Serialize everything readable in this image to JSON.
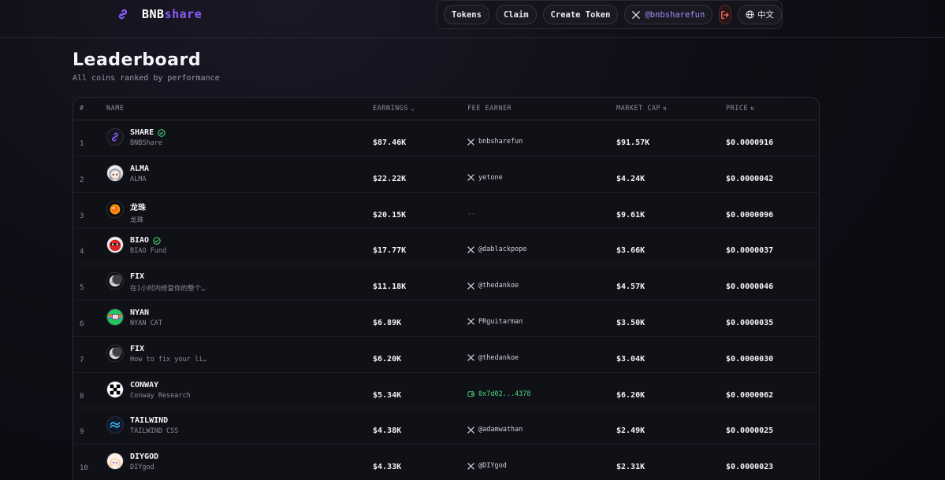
{
  "brand": {
    "part1": "BNB",
    "part2": "share",
    "icon": "link-icon",
    "accent": "#8b5cf6"
  },
  "nav": {
    "tokens": "Tokens",
    "claim": "Claim",
    "create_token": "Create Token",
    "twitter_handle": "@bnbsharefun",
    "language": "中文"
  },
  "page": {
    "title": "Leaderboard",
    "subtitle": "All coins ranked by performance"
  },
  "table": {
    "headers": {
      "rank": "#",
      "name": "NAME",
      "earnings": "EARNINGS",
      "fee_earner": "FEE EARNER",
      "market_cap": "MARKET CAP",
      "price": "PRICE"
    },
    "rows": [
      {
        "rank": "1",
        "name": "SHARE",
        "sub": "BNBShare",
        "verified": true,
        "earnings": "$87.46K",
        "fee_type": "x",
        "fee": "bnbsharefun",
        "mcap": "$91.57K",
        "price": "$0.0000916",
        "avatar": "link-icon"
      },
      {
        "rank": "2",
        "name": "ALMA",
        "sub": "ALMA",
        "verified": false,
        "earnings": "$22.22K",
        "fee_type": "x",
        "fee": "yetone",
        "mcap": "$4.24K",
        "price": "$0.0000042",
        "avatar": "anime-face-icon"
      },
      {
        "rank": "3",
        "name": "龙珠",
        "sub": "龙珠",
        "verified": false,
        "earnings": "$20.15K",
        "fee_type": "none",
        "fee": "--",
        "mcap": "$9.61K",
        "price": "$0.0000096",
        "avatar": "orange-ball-icon"
      },
      {
        "rank": "4",
        "name": "BIAO",
        "sub": "BIAO Fund",
        "verified": true,
        "earnings": "$17.77K",
        "fee_type": "x",
        "fee": "@dablackpope",
        "mcap": "$3.66K",
        "price": "$0.0000037",
        "avatar": "red-face-icon"
      },
      {
        "rank": "5",
        "name": "FIX",
        "sub": "在1小时内修复你的整个…",
        "verified": false,
        "earnings": "$11.18K",
        "fee_type": "x",
        "fee": "@thedankoe",
        "mcap": "$4.57K",
        "price": "$0.0000046",
        "avatar": "moon-icon"
      },
      {
        "rank": "6",
        "name": "NYAN",
        "sub": "NYAN CAT",
        "verified": false,
        "earnings": "$6.89K",
        "fee_type": "x",
        "fee": "PRguitarman",
        "mcap": "$3.50K",
        "price": "$0.0000035",
        "avatar": "nyan-cat-icon"
      },
      {
        "rank": "7",
        "name": "FIX",
        "sub": "How to fix your li…",
        "verified": false,
        "earnings": "$6.20K",
        "fee_type": "x",
        "fee": "@thedankoe",
        "mcap": "$3.04K",
        "price": "$0.0000030",
        "avatar": "moon-icon"
      },
      {
        "rank": "8",
        "name": "CONWAY",
        "sub": "Conway Research",
        "verified": false,
        "earnings": "$5.34K",
        "fee_type": "wallet",
        "fee": "0x7d02...4378",
        "mcap": "$6.20K",
        "price": "$0.0000062",
        "avatar": "conway-icon"
      },
      {
        "rank": "9",
        "name": "TAILWIND",
        "sub": "TAILWIND CSS",
        "verified": false,
        "earnings": "$4.38K",
        "fee_type": "x",
        "fee": "@adamwathan",
        "mcap": "$2.49K",
        "price": "$0.0000025",
        "avatar": "tailwind-icon"
      },
      {
        "rank": "10",
        "name": "DIYGOD",
        "sub": "DIYgod",
        "verified": false,
        "earnings": "$4.33K",
        "fee_type": "x",
        "fee": "@DIYgod",
        "mcap": "$2.31K",
        "price": "$0.0000023",
        "avatar": "anime-girl-icon"
      }
    ]
  }
}
